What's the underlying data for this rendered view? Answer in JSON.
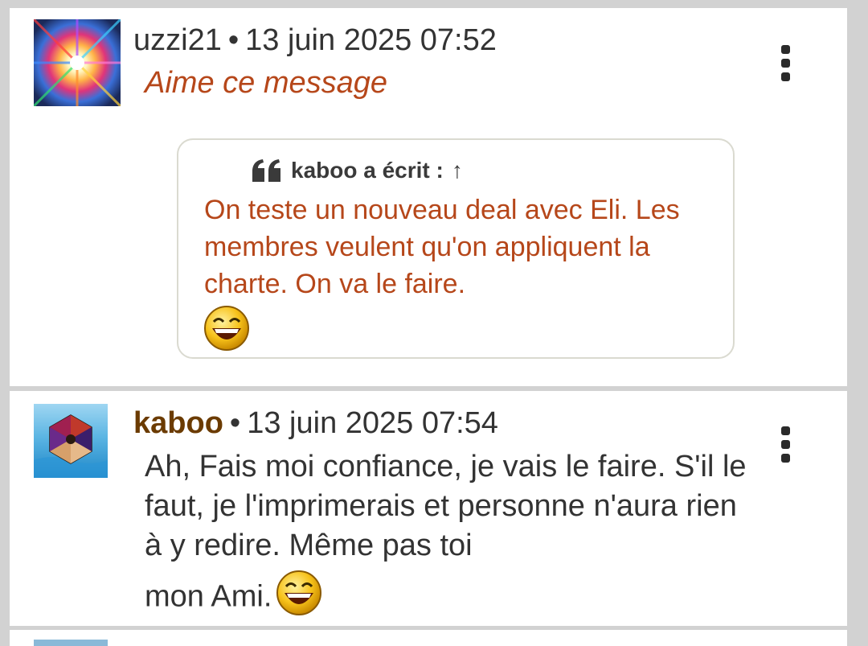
{
  "posts": [
    {
      "author": "uzzi21",
      "separator": "•",
      "timestamp": "13 juin 2025 07:52",
      "action": "Aime ce message",
      "quote": {
        "header": "kaboo a écrit :",
        "arrow": "↑",
        "text": "On teste un nouveau deal avec Eli. Les membres veulent qu'on appliquent la charte. On va le faire.",
        "emoji": "laughing-smiley"
      },
      "menu_icon": "more-vertical-icon"
    },
    {
      "author": "kaboo",
      "separator": "•",
      "timestamp": "13 juin 2025 07:54",
      "text_main": "Ah, Fais moi confiance, je vais le faire. S'il le faut, je l'imprimerais et personne n'aura rien à y redire. Même pas toi",
      "text_last": "mon Ami.",
      "emoji": "laughing-smiley",
      "menu_icon": "more-vertical-icon"
    }
  ],
  "colors": {
    "background": "#d2d2d2",
    "card": "#ffffff",
    "accent_text": "#b6471a",
    "author_highlight": "#6b3b00",
    "quote_border": "#dadad0"
  }
}
